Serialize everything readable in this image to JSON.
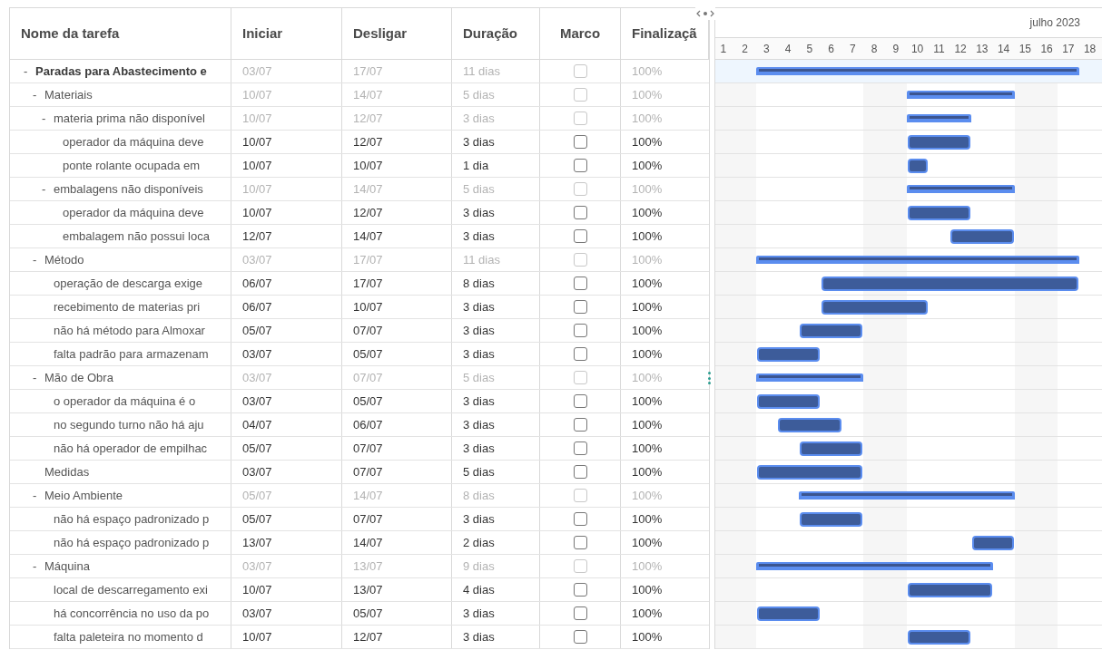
{
  "table": {
    "columns": [
      "Nome da tarefa",
      "Iniciar",
      "Desligar",
      "Duração",
      "Marco",
      "Finalizaçã"
    ],
    "rows": [
      {
        "kind": "summary",
        "name": "Paradas para Abastecimento e",
        "toggle": "-",
        "expanded": true,
        "selected": true,
        "start": "03/07",
        "end": "17/07",
        "duration": "11 dias",
        "milestone": false,
        "complete": "100%",
        "children": [
          {
            "kind": "summary",
            "name": "Materiais",
            "toggle": "-",
            "expanded": true,
            "selected": false,
            "start": "10/07",
            "end": "14/07",
            "duration": "5 dias",
            "milestone": false,
            "complete": "100%",
            "children": [
              {
                "kind": "summary",
                "name": "materia prima não disponível",
                "toggle": "-",
                "expanded": true,
                "selected": false,
                "start": "10/07",
                "end": "12/07",
                "duration": "3 dias",
                "milestone": false,
                "complete": "100%",
                "children": [
                  {
                    "kind": "task",
                    "name": "operador da máquina deve",
                    "selected": false,
                    "start": "10/07",
                    "end": "12/07",
                    "duration": "3 dias",
                    "milestone": false,
                    "complete": "100%"
                  },
                  {
                    "kind": "task",
                    "name": "ponte rolante ocupada em",
                    "selected": false,
                    "start": "10/07",
                    "end": "10/07",
                    "duration": "1 dia",
                    "milestone": false,
                    "complete": "100%"
                  }
                ]
              },
              {
                "kind": "summary",
                "name": "embalagens não disponíveis",
                "toggle": "-",
                "expanded": true,
                "selected": false,
                "start": "10/07",
                "end": "14/07",
                "duration": "5 dias",
                "milestone": false,
                "complete": "100%",
                "children": [
                  {
                    "kind": "task",
                    "name": "operador da máquina deve",
                    "selected": false,
                    "start": "10/07",
                    "end": "12/07",
                    "duration": "3 dias",
                    "milestone": false,
                    "complete": "100%"
                  },
                  {
                    "kind": "task",
                    "name": "embalagem não possui loca",
                    "selected": false,
                    "start": "12/07",
                    "end": "14/07",
                    "duration": "3 dias",
                    "milestone": false,
                    "complete": "100%"
                  }
                ]
              }
            ]
          },
          {
            "kind": "summary",
            "name": "Método",
            "toggle": "-",
            "expanded": true,
            "selected": false,
            "start": "03/07",
            "end": "17/07",
            "duration": "11 dias",
            "milestone": false,
            "complete": "100%",
            "children": [
              {
                "kind": "task",
                "name": "operação de descarga exige",
                "selected": false,
                "start": "06/07",
                "end": "17/07",
                "duration": "8 dias",
                "milestone": false,
                "complete": "100%"
              },
              {
                "kind": "task",
                "name": "recebimento de materias pri",
                "selected": false,
                "start": "06/07",
                "end": "10/07",
                "duration": "3 dias",
                "milestone": false,
                "complete": "100%"
              },
              {
                "kind": "task",
                "name": "não há método para Almoxar",
                "selected": false,
                "start": "05/07",
                "end": "07/07",
                "duration": "3 dias",
                "milestone": false,
                "complete": "100%"
              },
              {
                "kind": "task",
                "name": "falta padrão para armazenam",
                "selected": false,
                "start": "03/07",
                "end": "05/07",
                "duration": "3 dias",
                "milestone": false,
                "complete": "100%"
              }
            ]
          },
          {
            "kind": "summary",
            "name": "Mão de Obra",
            "toggle": "-",
            "expanded": true,
            "selected": false,
            "start": "03/07",
            "end": "07/07",
            "duration": "5 dias",
            "milestone": false,
            "complete": "100%",
            "children": [
              {
                "kind": "task",
                "name": "o operador da máquina é o",
                "selected": false,
                "start": "03/07",
                "end": "05/07",
                "duration": "3 dias",
                "milestone": false,
                "complete": "100%"
              },
              {
                "kind": "task",
                "name": "no segundo turno não há aju",
                "selected": false,
                "start": "04/07",
                "end": "06/07",
                "duration": "3 dias",
                "milestone": false,
                "complete": "100%"
              },
              {
                "kind": "task",
                "name": "não há operador de empilhac",
                "selected": false,
                "start": "05/07",
                "end": "07/07",
                "duration": "3 dias",
                "milestone": false,
                "complete": "100%"
              }
            ]
          },
          {
            "kind": "task",
            "name": "Medidas",
            "selected": false,
            "start": "03/07",
            "end": "07/07",
            "duration": "5 dias",
            "milestone": false,
            "complete": "100%"
          },
          {
            "kind": "summary",
            "name": "Meio Ambiente",
            "toggle": "-",
            "expanded": true,
            "selected": false,
            "start": "05/07",
            "end": "14/07",
            "duration": "8 dias",
            "milestone": false,
            "complete": "100%",
            "children": [
              {
                "kind": "task",
                "name": "não há espaço padronizado p",
                "selected": false,
                "start": "05/07",
                "end": "07/07",
                "duration": "3 dias",
                "milestone": false,
                "complete": "100%"
              },
              {
                "kind": "task",
                "name": "não há espaço padronizado p",
                "selected": false,
                "start": "13/07",
                "end": "14/07",
                "duration": "2 dias",
                "milestone": false,
                "complete": "100%"
              }
            ]
          },
          {
            "kind": "summary",
            "name": "Máquina",
            "toggle": "-",
            "expanded": true,
            "selected": false,
            "start": "03/07",
            "end": "13/07",
            "duration": "9 dias",
            "milestone": false,
            "complete": "100%",
            "children": [
              {
                "kind": "task",
                "name": "local de descarregamento exi",
                "selected": false,
                "start": "10/07",
                "end": "13/07",
                "duration": "4 dias",
                "milestone": false,
                "complete": "100%"
              },
              {
                "kind": "task",
                "name": "há concorrência no uso da po",
                "selected": false,
                "start": "03/07",
                "end": "05/07",
                "duration": "3 dias",
                "milestone": false,
                "complete": "100%"
              },
              {
                "kind": "task",
                "name": "falta paleteira no momento d",
                "selected": false,
                "start": "10/07",
                "end": "12/07",
                "duration": "3 dias",
                "milestone": false,
                "complete": "100%"
              }
            ]
          }
        ]
      }
    ]
  },
  "gantt": {
    "month": "julho 2023",
    "days": [
      "1",
      "2",
      "3",
      "4",
      "5",
      "6",
      "7",
      "8",
      "9",
      "10",
      "11",
      "12",
      "13",
      "14",
      "15",
      "16",
      "17",
      "18"
    ]
  }
}
